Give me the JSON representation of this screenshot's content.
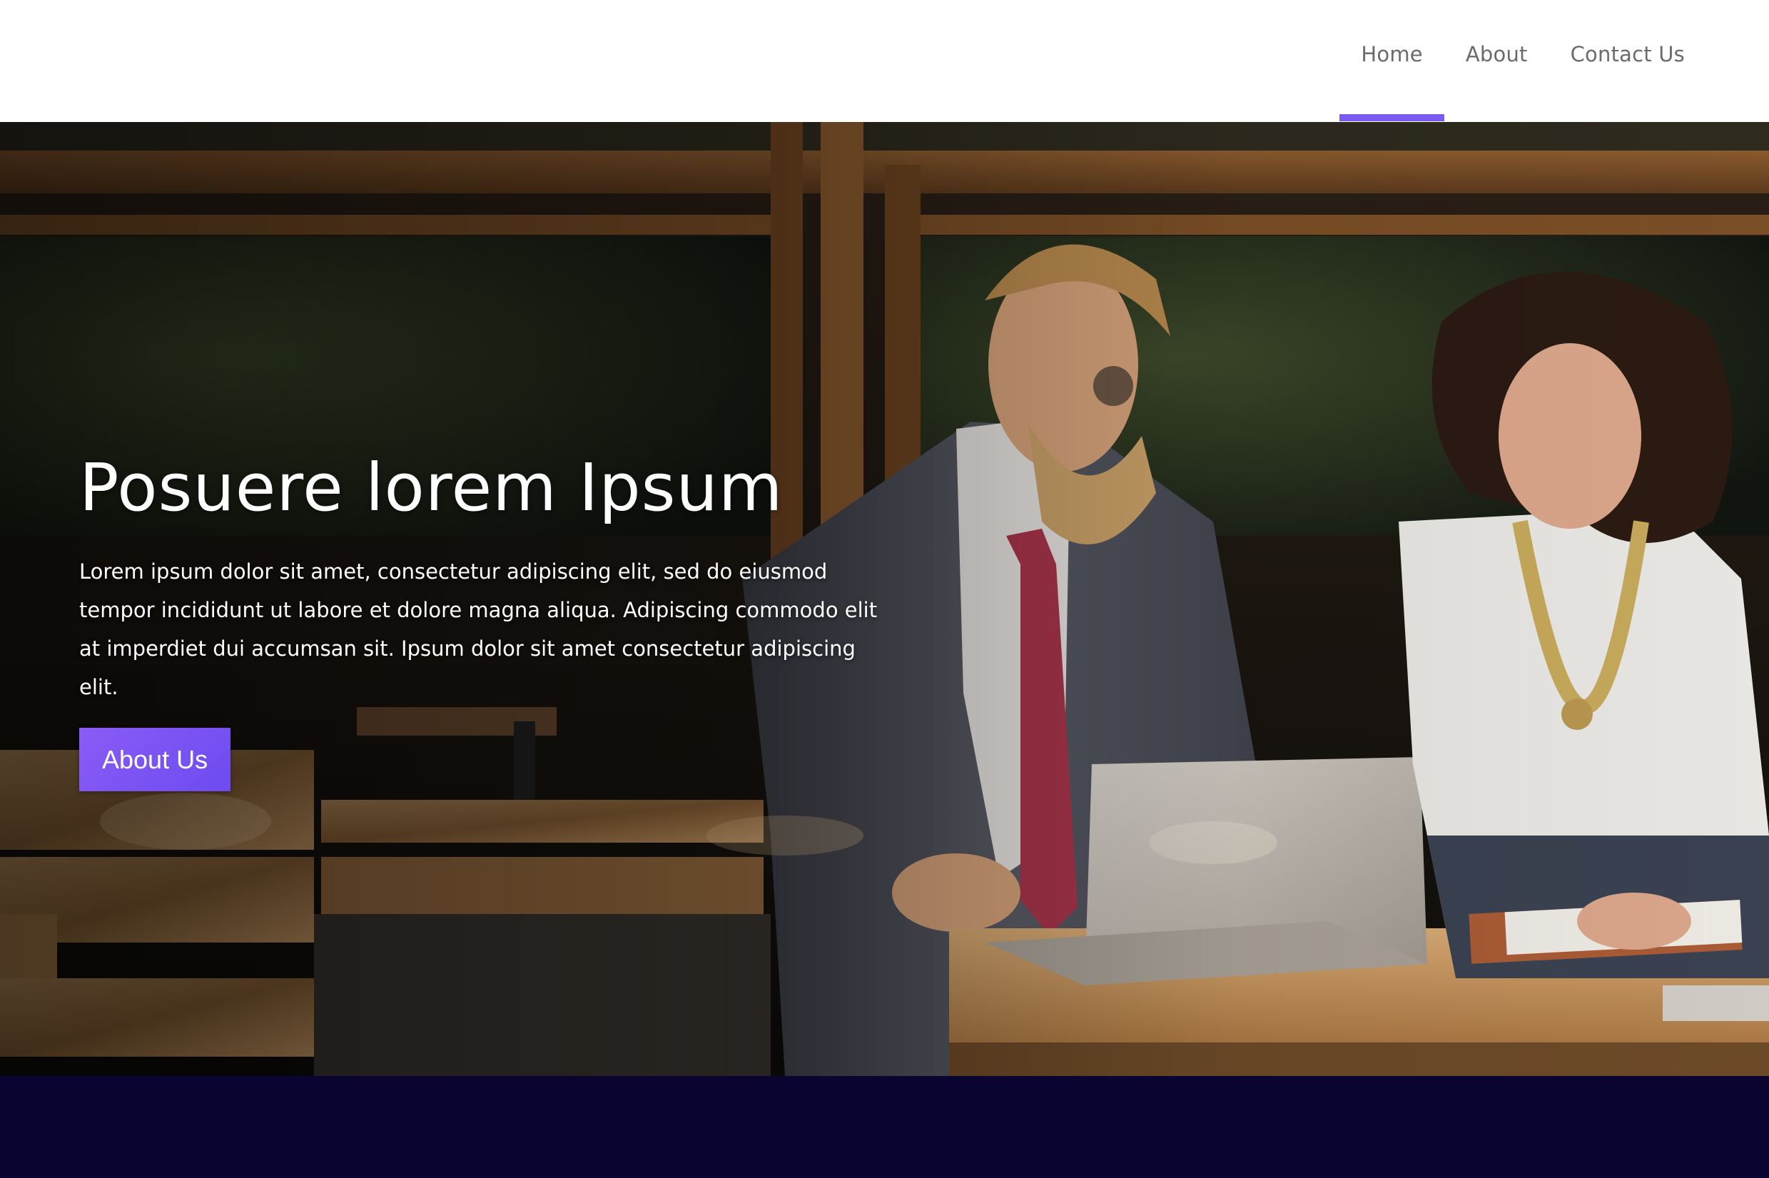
{
  "header": {
    "nav": [
      {
        "label": "Home",
        "active": true
      },
      {
        "label": "About",
        "active": false
      },
      {
        "label": "Contact Us",
        "active": false
      }
    ]
  },
  "hero": {
    "title": "Posuere lorem Ipsum",
    "text": "Lorem ipsum dolor sit amet, consectetur adipiscing elit, sed do eiusmod tempor incididunt ut labore et dolore magna aliqua. Adipiscing commodo elit at imperdiet dui accumsan sit. Ipsum dolor sit amet consectetur adipiscing elit.",
    "button_label": "About Us",
    "image_description": "two-people-working-on-laptop-photo"
  },
  "colors": {
    "accent": "#7b5cf0",
    "band": "#0a0430",
    "nav_text": "#6b6b6b"
  }
}
